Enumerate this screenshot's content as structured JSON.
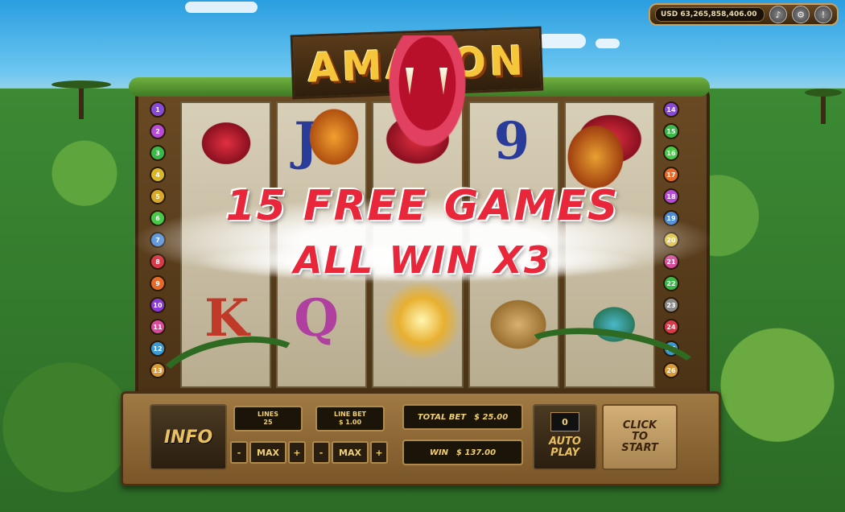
{
  "wallet": {
    "balance": "USD 63,265,858,406.00",
    "buttons": [
      {
        "icon": "speaker-icon",
        "glyph": "♪"
      },
      {
        "icon": "settings-icon",
        "glyph": "⚙"
      },
      {
        "icon": "info-icon",
        "glyph": "!"
      }
    ]
  },
  "logo": {
    "text": "AMAZON"
  },
  "banner": {
    "line1": "15 FREE GAMES",
    "line2": "ALL WIN X3"
  },
  "reels": {
    "symbols": [
      {
        "reel": 0,
        "text": "",
        "color": "#c0202a"
      },
      {
        "reel": 1,
        "text": "J",
        "color": "#2a3c9a"
      },
      {
        "reel": 2,
        "text": "",
        "color": "#c0202a"
      },
      {
        "reel": 3,
        "text": "9",
        "color": "#2a3c9a"
      },
      {
        "reel": 4,
        "text": "",
        "color": "#c0202a"
      },
      {
        "reel": 0,
        "text": "K",
        "color": "#c03a2a"
      },
      {
        "reel": 1,
        "text": "Q",
        "color": "#b040a0"
      },
      {
        "reel": 3,
        "text": "",
        "color": "#c09040"
      },
      {
        "reel": 4,
        "text": "",
        "color": "#3a8aa0"
      }
    ]
  },
  "paylines": {
    "left": [
      "1",
      "2",
      "3",
      "4",
      "5",
      "6",
      "7",
      "8",
      "9",
      "10",
      "11",
      "12",
      "13"
    ],
    "right": [
      "14",
      "15",
      "16",
      "17",
      "18",
      "19",
      "20",
      "21",
      "22",
      "23",
      "24",
      "25",
      "26"
    ],
    "colors": [
      "#8a4ad8",
      "#b84ad8",
      "#3ab84a",
      "#d8b82a",
      "#d8a82a",
      "#4ac84a",
      "#4a8ad8",
      "#d83a4a",
      "#e86a2a",
      "#8a3ad8",
      "#d84a9a",
      "#3a9ad8",
      "#d89a3a"
    ]
  },
  "controls": {
    "info": "INFO",
    "lines_label": "LINES",
    "lines_value": "25",
    "line_bet_label": "LINE BET",
    "line_bet_value": "$ 1.00",
    "minus": "-",
    "max": "MAX",
    "plus": "+",
    "total_bet_label": "TOTAL BET",
    "total_bet_value": "$ 25.00",
    "win_label": "WIN",
    "win_value": "$ 137.00",
    "auto_count": "0",
    "auto_label_1": "AUTO",
    "auto_label_2": "PLAY",
    "start_1": "CLICK",
    "start_2": "TO",
    "start_3": "START"
  }
}
